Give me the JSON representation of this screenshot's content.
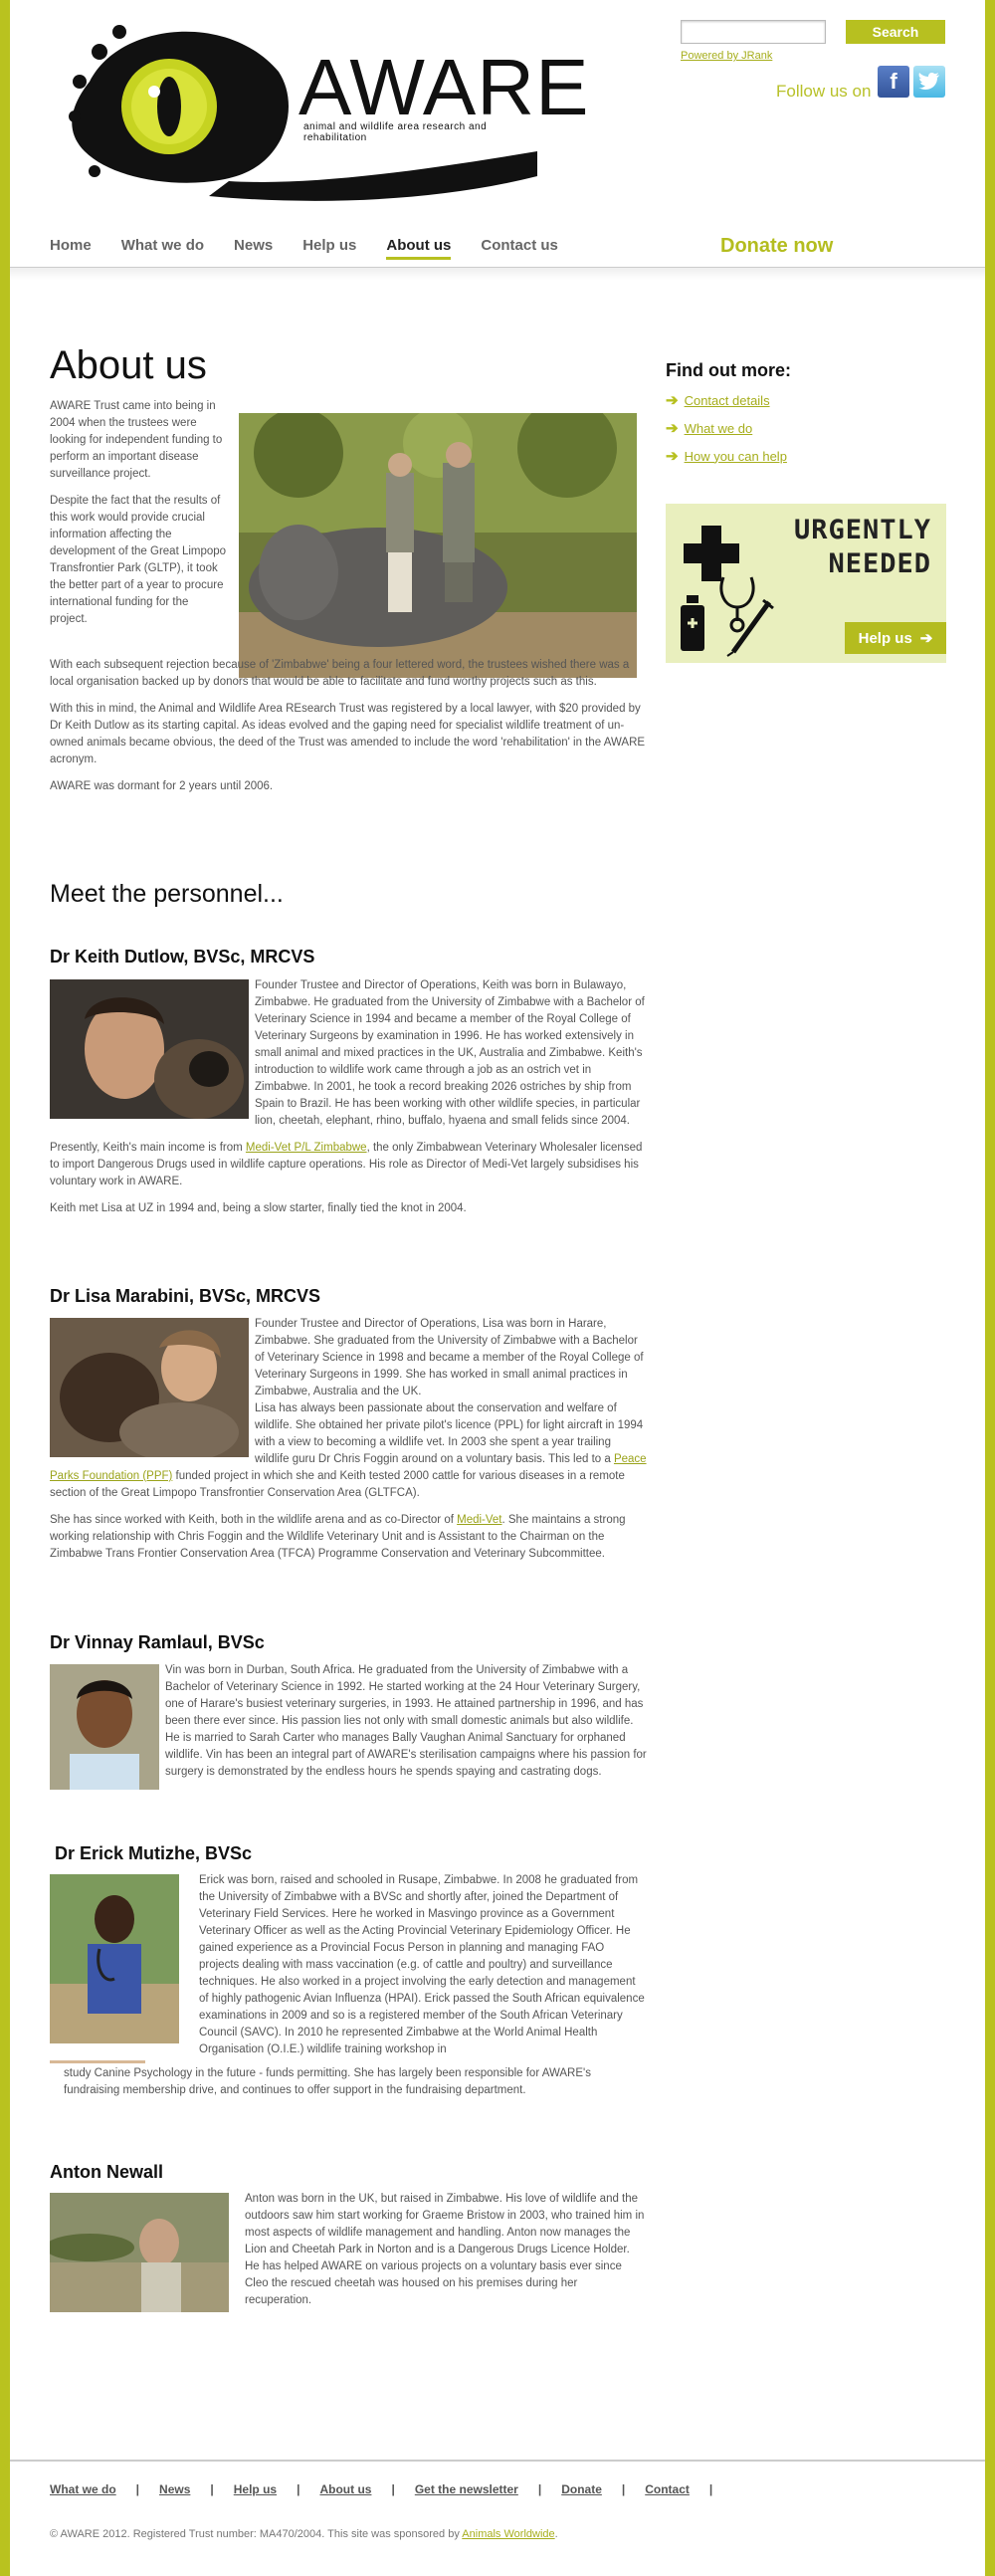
{
  "brand": {
    "name": "AWARE",
    "tagline": "animal and wildlife area research and rehabilitation"
  },
  "search": {
    "placeholder": "",
    "button_label": "Search",
    "powered_by": "Powered by JRank"
  },
  "social": {
    "follow_label": "Follow us on",
    "facebook_icon": "f",
    "twitter_icon": "t"
  },
  "nav": {
    "items": [
      {
        "label": "Home"
      },
      {
        "label": "What we do"
      },
      {
        "label": "News"
      },
      {
        "label": "Help us"
      },
      {
        "label": "About us"
      },
      {
        "label": "Contact us"
      }
    ],
    "active": "About us",
    "donate_label": "Donate now"
  },
  "about": {
    "title": "About us",
    "p1": "AWARE Trust came into being in 2004 when the trustees were looking for independent funding to perform an important disease surveillance project.",
    "p2": "Despite the fact that the results of this work would provide crucial information affecting the development of the Great Limpopo Transfrontier Park (GLTP), it took the better part of a year to procure international funding for the project.",
    "p3": "With each subsequent rejection because of 'Zimbabwe' being a four lettered word, the trustees wished there was a local organisation backed up by donors that would be able to facilitate and fund worthy projects such as this.",
    "p4": "With this in mind, the Animal and Wildlife Area REsearch Trust was registered by a local lawyer, with $20 provided by Dr Keith Dutlow as its starting capital. As ideas evolved and the gaping need for specialist wildlife treatment of un-owned animals became obvious, the deed of the Trust was amended to include the word 'rehabilitation' in the AWARE acronym.",
    "p5": "AWARE was dormant for 2 years until 2006."
  },
  "personnel": {
    "title": "Meet the personnel...",
    "keith": {
      "name": "Dr Keith Dutlow, BVSc, MRCVS",
      "p1": "Founder Trustee and Director of Operations, Keith was born in Bulawayo, Zimbabwe. He graduated from the University of Zimbabwe with a Bachelor of Veterinary Science in 1994 and became a member of the Royal College of Veterinary Surgeons by examination in 1996. He has worked extensively in small animal and mixed practices in the UK, Australia and Zimbabwe. Keith's introduction to wildlife work came through a job as an ostrich vet in Zimbabwe. In 2001, he took a record breaking 2026 ostriches by ship from Spain to Brazil. He has been working with other wildlife species, in particular lion, cheetah, elephant, rhino, buffalo, hyaena and small felids since 2004.",
      "p2_before": "Presently, Keith's main income is from ",
      "p2_link": "Medi-Vet P/L Zimbabwe",
      "p2_after": ", the only Zimbabwean Veterinary Wholesaler licensed to import Dangerous Drugs used in wildlife capture operations. His role as Director of Medi-Vet largely subsidises his voluntary work in AWARE.",
      "p3": "Keith met Lisa at UZ in 1994 and, being a slow starter, finally tied the knot in 2004."
    },
    "lisa": {
      "name": "Dr Lisa Marabini, BVSc, MRCVS",
      "p1": "Founder Trustee and Director of Operations, Lisa was born in Harare, Zimbabwe. She graduated from the University of Zimbabwe with a Bachelor of Veterinary Science in 1998 and became a member of the Royal College of Veterinary Surgeons in 1999. She has worked in small animal practices in Zimbabwe, Australia and the UK.",
      "p1b_before": "Lisa has always been passionate about the conservation and welfare of wildlife. She obtained her private pilot's licence (PPL) for light aircraft in 1994 with a view to becoming a wildlife vet. In 2003 she spent a year trailing wildlife guru Dr Chris Foggin around on a voluntary basis. This led to a ",
      "p1b_link": "Peace Parks Foundation (PPF)",
      "p1b_after": " funded project in which she and Keith tested 2000 cattle for various diseases in a remote section of the Great Limpopo Transfrontier Conservation Area (GLTFCA).",
      "p2_before": "She has since worked with Keith, both in the wildlife arena and as co-Director of ",
      "p2_link": "Medi-Vet",
      "p2_after": ". She maintains a strong working relationship with Chris Foggin and the Wildlife Veterinary Unit and is Assistant to the Chairman on the Zimbabwe Trans Frontier Conservation Area (TFCA) Programme Conservation and Veterinary Subcommittee."
    },
    "vinnay": {
      "name": "Dr Vinnay Ramlaul, BVSc",
      "p1": "Vin was born in Durban, South Africa. He graduated from the University of Zimbabwe with a Bachelor of Veterinary Science in 1992. He started working at the 24 Hour Veterinary Surgery, one of Harare's busiest veterinary surgeries, in 1993. He attained partnership in 1996, and has been there ever since. His passion lies not only with small domestic animals but also wildlife. He is married to Sarah Carter who manages Bally Vaughan Animal Sanctuary for orphaned wildlife. Vin has been an integral part of AWARE's sterilisation campaigns where his passion for surgery is demonstrated by the endless hours he spends spaying and castrating dogs."
    },
    "erick": {
      "name": "Dr Erick Mutizhe, BVSc",
      "p1": "Erick was born, raised and schooled in Rusape, Zimbabwe.  In 2008 he graduated from the University of Zimbabwe with a BVSc and shortly after, joined the Department of Veterinary Field Services.  Here he worked in Masvingo province as a Government Veterinary Officer as well as the Acting Provincial Veterinary Epidemiology Officer. He gained experience as a Provincial Focus Person in planning and managing FAO projects dealing with mass vaccination (e.g. of cattle and poultry) and surveillance techniques.  He also worked in a project involving the early detection and management of highly pathogenic Avian Influenza (HPAI). Erick passed the South African equivalence examinations in 2009 and so is a registered member of the South African Veterinary Council (SAVC). In 2010 he represented Zimbabwe at the World Animal Health Organisation (O.I.E.) wildlife training workshop in",
      "p1_tail": "study Canine Psychology in the future - funds permitting. She has largely been responsible for AWARE's fundraising membership drive, and continues to offer support in the fundraising department."
    },
    "anton": {
      "name": "Anton Newall",
      "p1": "Anton was born in the UK, but raised in Zimbabwe. His love of wildlife and the outdoors saw him start working for Graeme Bristow in 2003, who trained him in most aspects of wildlife management and handling. Anton now manages the Lion and Cheetah Park in Norton and is a Dangerous Drugs Licence Holder. He has helped AWARE on various projects on a voluntary basis ever since Cleo the rescued cheetah was housed on his premises during her recuperation."
    }
  },
  "sidebar": {
    "title": "Find out more:",
    "links": [
      {
        "label": "Contact details"
      },
      {
        "label": "What we do"
      },
      {
        "label": "How you can help"
      }
    ],
    "urgent_line1": "URGENTLY",
    "urgent_line2": "NEEDED",
    "help_label": "Help us"
  },
  "footer": {
    "links": [
      {
        "label": "What we do"
      },
      {
        "label": "News"
      },
      {
        "label": "Help us"
      },
      {
        "label": "About us"
      },
      {
        "label": "Get the newsletter"
      },
      {
        "label": "Donate"
      },
      {
        "label": "Contact"
      }
    ],
    "copyright_before": "© AWARE 2012. Registered Trust number: MA470/2004. This site was sponsored by ",
    "copyright_link": "Animals Worldwide",
    "copyright_after": "."
  },
  "colors": {
    "accent": "#b7c020",
    "background": "#b9c21f",
    "text": "#555555"
  }
}
